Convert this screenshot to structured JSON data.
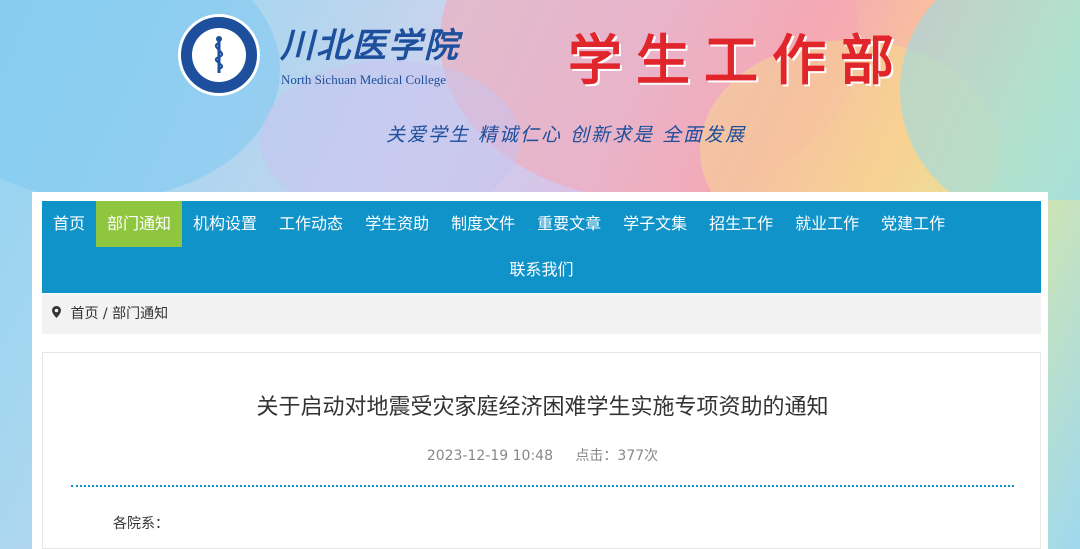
{
  "header": {
    "school_name": "川北医学院",
    "school_name_en": "North Sichuan Medical College",
    "dept_title": "学生工作部",
    "slogan": "关爱学生 精诚仁心 创新求是 全面发展"
  },
  "nav": {
    "row1": [
      "首页",
      "部门通知",
      "机构设置",
      "工作动态",
      "学生资助",
      "制度文件",
      "重要文章",
      "学子文集",
      "招生工作",
      "就业工作",
      "党建工作"
    ],
    "row2": [
      "联系我们"
    ],
    "active": "部门通知"
  },
  "breadcrumb": {
    "home": "首页",
    "separator": "/",
    "current": "部门通知"
  },
  "article": {
    "title": "关于启动对地震受灾家庭经济困难学生实施专项资助的通知",
    "date": "2023-12-19 10:48",
    "views": "点击：377次",
    "salutation": "各院系："
  },
  "colors": {
    "nav_bg": "#0f93c9",
    "nav_active": "#8ec63f",
    "title_red": "#e0262b",
    "brand_blue": "#1d4f9c"
  }
}
